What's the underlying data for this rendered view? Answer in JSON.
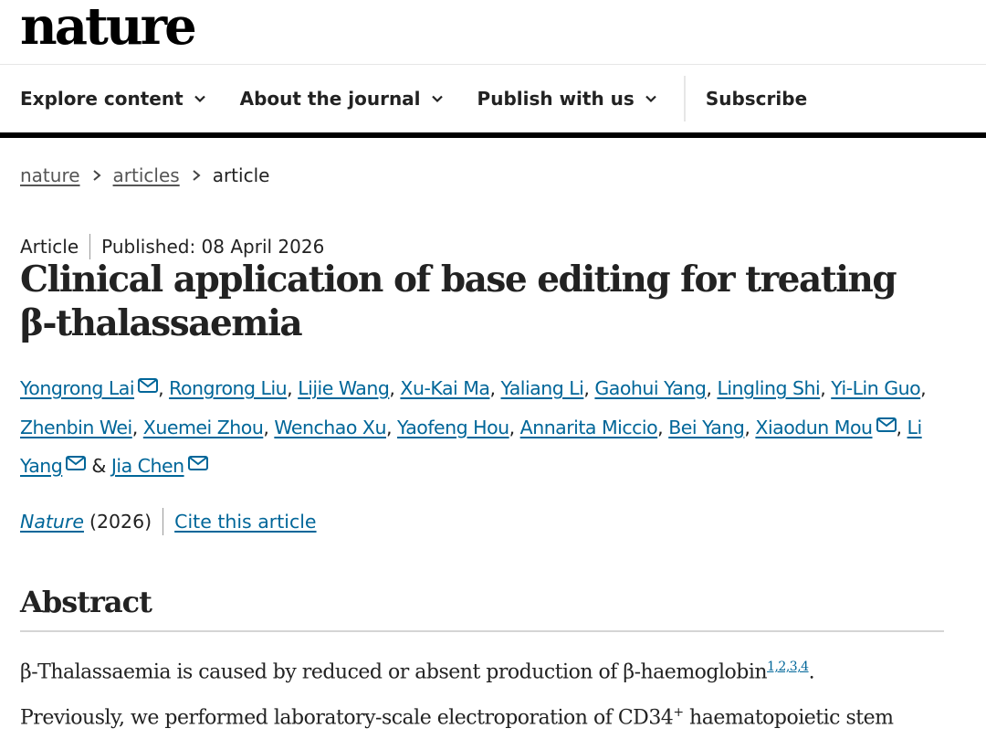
{
  "header": {
    "logo": "nature"
  },
  "nav": {
    "items": [
      {
        "label": "Explore content"
      },
      {
        "label": "About the journal"
      },
      {
        "label": "Publish with us"
      }
    ],
    "subscribe": "Subscribe"
  },
  "breadcrumb": {
    "items": [
      "nature",
      "articles"
    ],
    "current": "article"
  },
  "meta": {
    "type": "Article",
    "published": "Published: 08 April 2026"
  },
  "article": {
    "title": "Clinical application of base editing for treating β-thalassaemia",
    "authors": [
      "Yongrong Lai",
      "Rongrong Liu",
      "Lijie Wang",
      "Xu-Kai Ma",
      "Yaliang Li",
      "Gaohui Yang",
      "Lingling Shi",
      "Yi-Lin Guo",
      "Zhenbin Wei",
      "Xuemei Zhou",
      "Wenchao Xu",
      "Yaofeng Hou",
      "Annarita Miccio",
      "Bei Yang",
      "Xiaodun Mou",
      "Li Yang",
      "Jia Chen"
    ],
    "authors_and": "&",
    "journal": "Nature",
    "year": "(2026)",
    "cite": "Cite this article"
  },
  "abstract": {
    "heading": "Abstract",
    "line1": "β-Thalassaemia is caused by reduced or absent production of β-haemoglobin",
    "refs": "1,2,3,4",
    "line2a": "Previously, we performed laboratory-scale electroporation of CD34",
    "line2sup": "+",
    "line2b": " haematopoietic stem"
  },
  "icons": {
    "chevron": "chevron-down-icon",
    "mail": "mail-icon",
    "crumb_sep": "chevron-right-icon"
  }
}
